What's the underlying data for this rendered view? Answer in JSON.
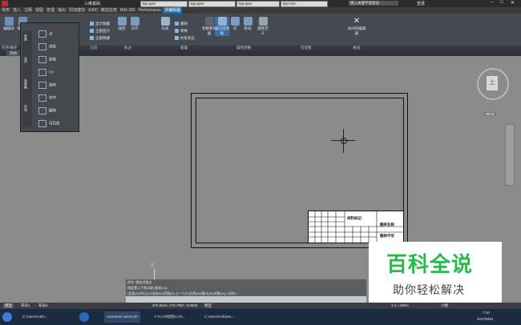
{
  "title": {
    "workspace": "三维基础",
    "window_right": "键入关键字或短语",
    "user": "登录"
  },
  "ribbon_tabs": [
    "常用",
    "插入",
    "注释",
    "视图",
    "管理",
    "输出",
    "附加模块",
    "A360",
    "精选应用",
    "BIM 360",
    "Performance",
    "块编辑器"
  ],
  "ribbon_active_tab": "块编辑器",
  "properties": {
    "layer": "ByLayer",
    "linetype1": "ByLayer",
    "linetype2": "ByLayer",
    "color": "ByColor"
  },
  "ribbon_buttons": {
    "edit_block": "编辑块",
    "save_block": "保存块",
    "show_hide": "显示隐藏",
    "all_show": "全部显示",
    "all_hide": "全部隐藏",
    "constrain": "线性",
    "align": "对齐",
    "block_table": "块表",
    "delete": "删除",
    "convert": "转换",
    "constraint_status": "约束状态",
    "param_manager": "参数管理器",
    "authoring": "编写选项板",
    "point": "点",
    "move": "移动",
    "attribute": "属性定义",
    "close_editor": "关闭块编辑器"
  },
  "panel_labels": [
    "打开/保存",
    "几何",
    "标注",
    "管理",
    "操作参数",
    "可见性",
    "关闭"
  ],
  "file_tab": "开始",
  "flyout_items": [
    "点",
    "线性",
    "极轴",
    "XY",
    "旋转",
    "对齐",
    "翻转",
    "可见性"
  ],
  "flyout_side_labels": [
    "参数",
    "动作",
    "参数集",
    "约束"
  ],
  "title_block": {
    "drawing_name": "图样名称",
    "drawing_no": "图样代号",
    "material": "材料标记"
  },
  "command": {
    "line1": "命令: 指定对角点",
    "line2": "指定第二个角点或 [放弃(U)]:",
    "line3": "[全部(A)/中心(C)/动态(D)/范围(E)/上一个(P)/比例(S)/窗口(W)/对象(O)] <实时>:"
  },
  "model_tabs": [
    "模型",
    "布局1",
    "布局2"
  ],
  "status": {
    "coords": "375.0541, 270.7567, 0.0000",
    "model_label": "模型",
    "scale": "1:1 / 100%",
    "units": "小数"
  },
  "taskbar": {
    "items": [
      "C:\\Users\\Adm...",
      "Autodesk AutoCAD",
      "F:\\CAD绘图\\CAD...",
      "C:\\Users\\Ad\\Des..."
    ],
    "time": "7:10",
    "date": "2017/8/20"
  },
  "viewcube": {
    "face": "上",
    "wcs": "WCS"
  },
  "watermark": {
    "line1": "百科全说",
    "line2": "助你轻松解决"
  }
}
